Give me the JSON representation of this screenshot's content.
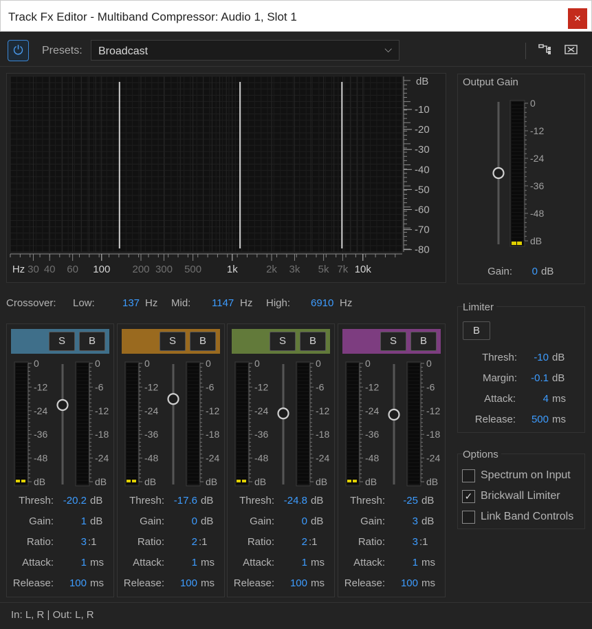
{
  "window": {
    "title": "Track Fx Editor - Multiband Compressor: Audio 1, Slot 1",
    "close_label": "×"
  },
  "toolbar": {
    "power_icon": "power-icon",
    "presets_label": "Presets:",
    "preset_value": "Broadcast",
    "routing_icon": "routing-icon",
    "close_panel_icon": "close-panel-icon"
  },
  "graph": {
    "db_header": "dB",
    "db_ticks": [
      "-10",
      "-20",
      "-30",
      "-40",
      "-50",
      "-60",
      "-70",
      "-80"
    ],
    "freq_ticks": [
      {
        "label": "Hz",
        "bright": true
      },
      {
        "label": "30",
        "bright": false
      },
      {
        "label": "40",
        "bright": false
      },
      {
        "label": "60",
        "bright": false
      },
      {
        "label": "100",
        "bright": true
      },
      {
        "label": "200",
        "bright": false
      },
      {
        "label": "300",
        "bright": false
      },
      {
        "label": "500",
        "bright": false
      },
      {
        "label": "1k",
        "bright": true
      },
      {
        "label": "2k",
        "bright": false
      },
      {
        "label": "3k",
        "bright": false
      },
      {
        "label": "5k",
        "bright": false
      },
      {
        "label": "7k",
        "bright": false
      },
      {
        "label": "10k",
        "bright": true
      }
    ],
    "crossover_freqs_hz": [
      137,
      1147,
      6910
    ]
  },
  "crossover": {
    "label": "Crossover:",
    "low_label": "Low:",
    "low_value": "137",
    "mid_label": "Mid:",
    "mid_value": "1147",
    "high_label": "High:",
    "high_value": "6910",
    "unit": "Hz"
  },
  "band_meter_labels_left": [
    "0",
    "-12",
    "-24",
    "-36",
    "-48",
    "dB"
  ],
  "band_meter_labels_right": [
    "0",
    "-6",
    "-12",
    "-18",
    "-24",
    "dB"
  ],
  "band_param_labels": {
    "thresh": "Thresh:",
    "gain": "Gain:",
    "ratio": "Ratio:",
    "attack": "Attack:",
    "release": "Release:"
  },
  "band_param_units": {
    "thresh": "dB",
    "gain": "dB",
    "ratio": ":1",
    "attack": "ms",
    "release": "ms"
  },
  "bands": [
    {
      "color": "#3f6f8a",
      "solo_label": "S",
      "bypass_label": "B",
      "thresh": "-20.2",
      "gain": "1",
      "ratio": "3",
      "attack": "1",
      "release": "100",
      "knob_level": 0.34
    },
    {
      "color": "#9a6a1f",
      "solo_label": "S",
      "bypass_label": "B",
      "thresh": "-17.6",
      "gain": "0",
      "ratio": "2",
      "attack": "1",
      "release": "100",
      "knob_level": 0.29
    },
    {
      "color": "#627a3a",
      "solo_label": "S",
      "bypass_label": "B",
      "thresh": "-24.8",
      "gain": "0",
      "ratio": "2",
      "attack": "1",
      "release": "100",
      "knob_level": 0.41
    },
    {
      "color": "#7d3d80",
      "solo_label": "S",
      "bypass_label": "B",
      "thresh": "-25",
      "gain": "3",
      "ratio": "3",
      "attack": "1",
      "release": "100",
      "knob_level": 0.42
    }
  ],
  "output_gain": {
    "title": "Output Gain",
    "meter_labels": [
      "0",
      "-12",
      "-24",
      "-36",
      "-48",
      "dB"
    ],
    "gain_label": "Gain:",
    "gain_value": "0",
    "gain_unit": "dB",
    "slider_level": 0.5
  },
  "limiter": {
    "title": "Limiter",
    "bypass_label": "B",
    "thresh_label": "Thresh:",
    "thresh_value": "-10",
    "thresh_unit": "dB",
    "margin_label": "Margin:",
    "margin_value": "-0.1",
    "margin_unit": "dB",
    "attack_label": "Attack:",
    "attack_value": "4",
    "attack_unit": "ms",
    "release_label": "Release:",
    "release_value": "500",
    "release_unit": "ms"
  },
  "options": {
    "title": "Options",
    "items": [
      {
        "label": "Spectrum on Input",
        "checked": false,
        "mark": ""
      },
      {
        "label": "Brickwall Limiter",
        "checked": true,
        "mark": "✓"
      },
      {
        "label": "Link Band Controls",
        "checked": false,
        "mark": ""
      }
    ]
  },
  "footer": {
    "io_text": "In: L, R | Out: L, R"
  },
  "colors": {
    "accent_value": "#3d9cff",
    "meter_peak": "#e0d000"
  }
}
